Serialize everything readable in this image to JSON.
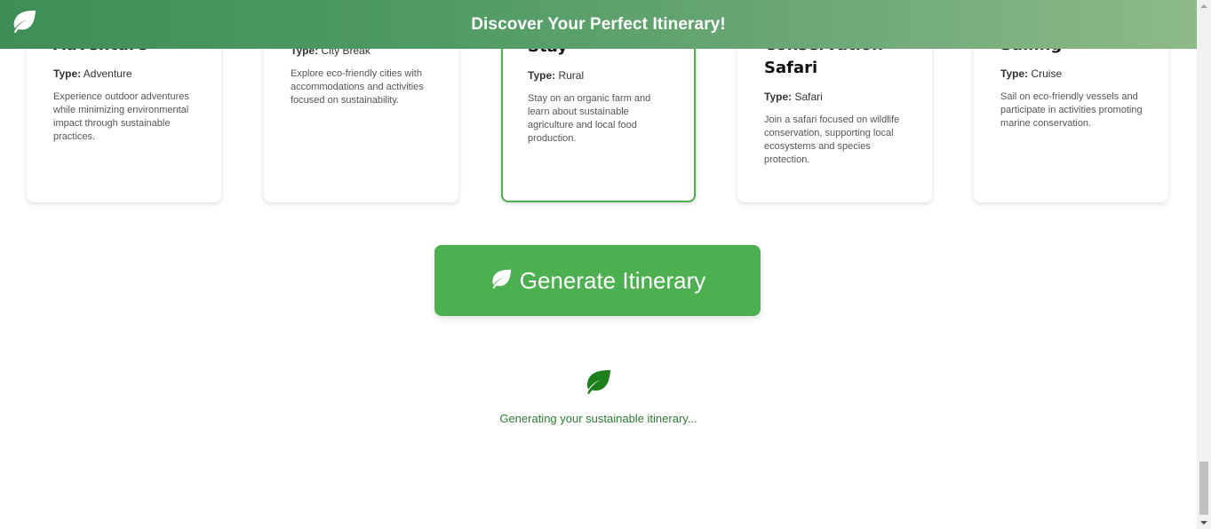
{
  "header": {
    "title": "Discover Your Perfect Itinerary!",
    "logo_icon": "leaf-icon",
    "gradient_start": "#3f8e57",
    "gradient_end": "#8dba88"
  },
  "cards": [
    {
      "title": "Adventure",
      "type_label": "Type:",
      "type_value": "Adventure",
      "description": "Experience outdoor adventures while minimizing environmental impact through sustainable practices.",
      "selected": false
    },
    {
      "title": "",
      "type_label": "Type:",
      "type_value": "City Break",
      "description": "Explore eco-friendly cities with accommodations and activities focused on sustainability.",
      "selected": false
    },
    {
      "title": "Stay",
      "type_label": "Type:",
      "type_value": "Rural",
      "description": "Stay on an organic farm and learn about sustainable agriculture and local food production.",
      "selected": true
    },
    {
      "title": "Conservation Safari",
      "type_label": "Type:",
      "type_value": "Safari",
      "description": "Join a safari focused on wildlife conservation, supporting local ecosystems and species protection.",
      "selected": false
    },
    {
      "title": "Sailing",
      "type_label": "Type:",
      "type_value": "Cruise",
      "description": "Sail on eco-friendly vessels and participate in activities promoting marine conservation.",
      "selected": false
    }
  ],
  "generate_button": {
    "label": "Generate Itinerary",
    "icon": "leaf-icon",
    "color": "#4caf50"
  },
  "loading": {
    "icon": "leaf-icon",
    "text": "Generating your sustainable itinerary...",
    "color": "#2e7d32"
  },
  "colors": {
    "accent": "#4caf50",
    "selected_border": "#4caf50"
  }
}
